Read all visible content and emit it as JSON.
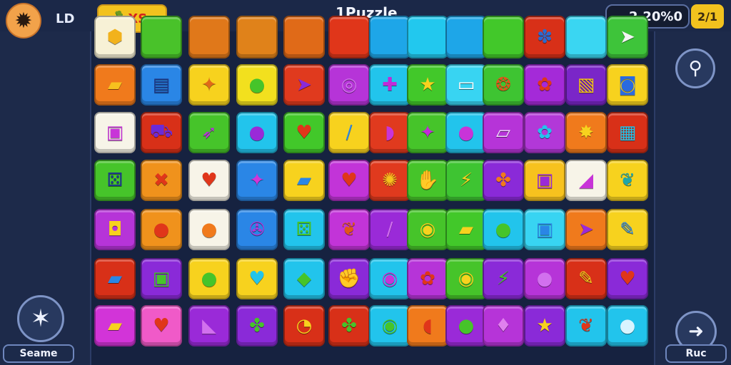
{
  "header": {
    "level_label": "LD",
    "badge_text": "XS",
    "title": "1Puzzle",
    "score": "2.20%0",
    "moves": "2/1"
  },
  "icons": {
    "gear": "gear-icon",
    "badge": "carrot-bag-icon",
    "search": "search-icon",
    "star": "star-icon",
    "arrow": "arrow-icon"
  },
  "buttons": {
    "left_label": "Seame",
    "right_label": "Ruc"
  },
  "colors": {
    "background": "#1d2a4a",
    "accent": "#f2c21e"
  },
  "grid": {
    "rows": [
      [
        {
          "name": "half-tile",
          "bg": "#f7f1d6",
          "glyph": "⬢",
          "fg": "#f2b21c"
        },
        {
          "name": "green-tile",
          "bg": "#49c22a",
          "glyph": "",
          "fg": "#fff"
        },
        {
          "name": "orange-tile",
          "bg": "#e0781a",
          "glyph": "",
          "fg": "#fff"
        },
        {
          "name": "orange-tile",
          "bg": "#e0821a",
          "glyph": "",
          "fg": "#fff"
        },
        {
          "name": "orange-tile",
          "bg": "#e06a18",
          "glyph": "",
          "fg": "#fff"
        },
        {
          "name": "red-tile",
          "bg": "#e0361a",
          "glyph": "",
          "fg": "#fff"
        },
        {
          "name": "blue-tile",
          "bg": "#1ea6e8",
          "glyph": "",
          "fg": "#fff"
        },
        {
          "name": "cyan-tile",
          "bg": "#22c8ee",
          "glyph": "",
          "fg": "#fff"
        },
        {
          "name": "blue-tile",
          "bg": "#1ea6e8",
          "glyph": "",
          "fg": "#fff"
        },
        {
          "name": "green-tile",
          "bg": "#42c82a",
          "glyph": "",
          "fg": "#fff"
        },
        {
          "name": "red-tile",
          "bg": "#d83018",
          "glyph": "✽",
          "fg": "#2a6ad0"
        },
        {
          "name": "cyan-tile",
          "bg": "#3ad6f2",
          "glyph": "",
          "fg": "#fff"
        },
        {
          "name": "green-tile",
          "bg": "#3ec43a",
          "glyph": "➤",
          "fg": "#f4f4f4"
        }
      ],
      [
        {
          "name": "orange-tile",
          "bg": "#f07a1c",
          "glyph": "▰",
          "fg": "#f7c21e"
        },
        {
          "name": "blue-tile",
          "bg": "#2a86e6",
          "glyph": "▤",
          "fg": "#1e3a8a"
        },
        {
          "name": "yellow-tile",
          "bg": "#f7d21e",
          "glyph": "✦",
          "fg": "#e06a18"
        },
        {
          "name": "yellow-tile",
          "bg": "#f2e01e",
          "glyph": "●",
          "fg": "#46c42a"
        },
        {
          "name": "red-tile",
          "bg": "#e03a1e",
          "glyph": "➤",
          "fg": "#8a2ad8"
        },
        {
          "name": "purple-tile",
          "bg": "#b634d8",
          "glyph": "◎",
          "fg": "#d270ee"
        },
        {
          "name": "cyan-tile",
          "bg": "#22c4ec",
          "glyph": "✚",
          "fg": "#c22ad8"
        },
        {
          "name": "green-tile",
          "bg": "#42c82a",
          "glyph": "★",
          "fg": "#f7d21e"
        },
        {
          "name": "cyan-tile",
          "bg": "#38d4f2",
          "glyph": "▭",
          "fg": "#ffffff"
        },
        {
          "name": "green-tile",
          "bg": "#3ec432",
          "glyph": "❂",
          "fg": "#e0561a"
        },
        {
          "name": "purple-tile",
          "bg": "#a42ad8",
          "glyph": "✿",
          "fg": "#e0361a"
        },
        {
          "name": "purple-tile",
          "bg": "#7a26c8",
          "glyph": "▧",
          "fg": "#f2c21e"
        },
        {
          "name": "yellow-tile",
          "bg": "#f7d21e",
          "glyph": "◙",
          "fg": "#2a6ae0"
        }
      ],
      [
        {
          "name": "white-tile",
          "bg": "#f7f4e8",
          "glyph": "▣",
          "fg": "#c834d8"
        },
        {
          "name": "red-tile",
          "bg": "#d83018",
          "glyph": "⛟",
          "fg": "#6a2ad8"
        },
        {
          "name": "green-tile",
          "bg": "#46c42a",
          "glyph": "➶",
          "fg": "#b634d8"
        },
        {
          "name": "cyan-tile",
          "bg": "#22c4ec",
          "glyph": "●",
          "fg": "#9a2ad8"
        },
        {
          "name": "green-tile",
          "bg": "#42c82a",
          "glyph": "♥",
          "fg": "#e0361a"
        },
        {
          "name": "yellow-tile",
          "bg": "#f7d21e",
          "glyph": "/",
          "fg": "#2a86e6"
        },
        {
          "name": "red-tile",
          "bg": "#e03a1e",
          "glyph": "◗",
          "fg": "#c834d8"
        },
        {
          "name": "green-tile",
          "bg": "#46c42a",
          "glyph": "✦",
          "fg": "#c22ad8"
        },
        {
          "name": "cyan-tile",
          "bg": "#22c4ec",
          "glyph": "●",
          "fg": "#c834d8"
        },
        {
          "name": "purple-tile",
          "bg": "#b634d8",
          "glyph": "▱",
          "fg": "#f4e0ff"
        },
        {
          "name": "purple-tile",
          "bg": "#b238d8",
          "glyph": "✿",
          "fg": "#22c4ec"
        },
        {
          "name": "orange-tile",
          "bg": "#f07a1c",
          "glyph": "✸",
          "fg": "#f7d21e"
        },
        {
          "name": "red-tile",
          "bg": "#d83018",
          "glyph": "▦",
          "fg": "#22c4ec"
        }
      ],
      [
        {
          "name": "green-tile",
          "bg": "#46c42a",
          "glyph": "⚄",
          "fg": "#1e3a8a"
        },
        {
          "name": "orange-tile",
          "bg": "#f0921c",
          "glyph": "✖",
          "fg": "#e0361a"
        },
        {
          "name": "white-tile",
          "bg": "#f7f4e8",
          "glyph": "♥",
          "fg": "#e0361a"
        },
        {
          "name": "blue-tile",
          "bg": "#2a86e6",
          "glyph": "✦",
          "fg": "#d234d8"
        },
        {
          "name": "yellow-tile",
          "bg": "#f7d21e",
          "glyph": "▰",
          "fg": "#2a86e6"
        },
        {
          "name": "purple-tile",
          "bg": "#c234d8",
          "glyph": "♥",
          "fg": "#e0361a"
        },
        {
          "name": "red-tile",
          "bg": "#e03a1e",
          "glyph": "✺",
          "fg": "#f7c21e"
        },
        {
          "name": "green-tile",
          "bg": "#46c42a",
          "glyph": "✋",
          "fg": "#1e7ad8"
        },
        {
          "name": "green-tile",
          "bg": "#3ec432",
          "glyph": "⚡",
          "fg": "#f7d21e"
        },
        {
          "name": "purple-tile",
          "bg": "#8a2ad8",
          "glyph": "✤",
          "fg": "#f07a1c"
        },
        {
          "name": "yellow-tile",
          "bg": "#f7c21e",
          "glyph": "▣",
          "fg": "#9a2ad8"
        },
        {
          "name": "white-tile",
          "bg": "#f7f4e8",
          "glyph": "◢",
          "fg": "#c834d8"
        },
        {
          "name": "yellow-tile",
          "bg": "#f7d21e",
          "glyph": "❦",
          "fg": "#1ea6a8"
        }
      ],
      [
        {
          "name": "purple-tile",
          "bg": "#b634d8",
          "glyph": "◘",
          "fg": "#f7d21e"
        },
        {
          "name": "orange-tile",
          "bg": "#f0921c",
          "glyph": "●",
          "fg": "#e0361a"
        },
        {
          "name": "white-tile",
          "bg": "#f7f4e8",
          "glyph": "●",
          "fg": "#f07a1c"
        },
        {
          "name": "blue-tile",
          "bg": "#2a86e6",
          "glyph": "✇",
          "fg": "#b634d8"
        },
        {
          "name": "cyan-tile",
          "bg": "#22c4ec",
          "glyph": "⚄",
          "fg": "#46c42a"
        },
        {
          "name": "purple-tile",
          "bg": "#c234d8",
          "glyph": "❦",
          "fg": "#e0561a"
        },
        {
          "name": "purple-tile",
          "bg": "#9a2ad8",
          "glyph": "/",
          "fg": "#d270ee"
        },
        {
          "name": "green-tile",
          "bg": "#46c42a",
          "glyph": "◉",
          "fg": "#f7d21e"
        },
        {
          "name": "green-tile",
          "bg": "#42c82a",
          "glyph": "▰",
          "fg": "#f7d21e"
        },
        {
          "name": "cyan-tile",
          "bg": "#22c4ec",
          "glyph": "●",
          "fg": "#46c42a"
        },
        {
          "name": "cyan-tile",
          "bg": "#38d4f2",
          "glyph": "▣",
          "fg": "#2a86e6"
        },
        {
          "name": "orange-tile",
          "bg": "#f07a1c",
          "glyph": "➤",
          "fg": "#9a2ad8"
        },
        {
          "name": "yellow-tile",
          "bg": "#f7d21e",
          "glyph": "✎",
          "fg": "#2a86e6"
        }
      ],
      [
        {
          "name": "red-tile",
          "bg": "#d83018",
          "glyph": "▰",
          "fg": "#2a86e6"
        },
        {
          "name": "purple-tile",
          "bg": "#8a2ad8",
          "glyph": "▣",
          "fg": "#46c42a"
        },
        {
          "name": "yellow-tile",
          "bg": "#f7d21e",
          "glyph": "●",
          "fg": "#46c42a"
        },
        {
          "name": "yellow-tile",
          "bg": "#f7d21e",
          "glyph": "♥",
          "fg": "#22c4ec"
        },
        {
          "name": "cyan-tile",
          "bg": "#22c4ec",
          "glyph": "◆",
          "fg": "#46c42a"
        },
        {
          "name": "purple-tile",
          "bg": "#8a2ad8",
          "glyph": "✊",
          "fg": "#46c42a"
        },
        {
          "name": "cyan-tile",
          "bg": "#22c4ec",
          "glyph": "◉",
          "fg": "#c834d8"
        },
        {
          "name": "purple-tile",
          "bg": "#b634d8",
          "glyph": "✿",
          "fg": "#e0361a"
        },
        {
          "name": "green-tile",
          "bg": "#46c42a",
          "glyph": "◉",
          "fg": "#f7d21e"
        },
        {
          "name": "purple-tile",
          "bg": "#8a2ad8",
          "glyph": "⚡",
          "fg": "#46c42a"
        },
        {
          "name": "purple-tile",
          "bg": "#b634d8",
          "glyph": "●",
          "fg": "#d270ee"
        },
        {
          "name": "red-tile",
          "bg": "#d83018",
          "glyph": "✎",
          "fg": "#f7d21e"
        },
        {
          "name": "purple-tile",
          "bg": "#8a2ad8",
          "glyph": "♥",
          "fg": "#e0361a"
        }
      ],
      [
        {
          "name": "purple-tile",
          "bg": "#d234d8",
          "glyph": "▰",
          "fg": "#f7d21e"
        },
        {
          "name": "pink-tile",
          "bg": "#f05ac8",
          "glyph": "♥",
          "fg": "#e0361a"
        },
        {
          "name": "purple-tile",
          "bg": "#9a2ad8",
          "glyph": "◣",
          "fg": "#d270ee"
        },
        {
          "name": "purple-tile",
          "bg": "#8a2ad8",
          "glyph": "✤",
          "fg": "#46c42a"
        },
        {
          "name": "red-tile",
          "bg": "#d83018",
          "glyph": "◔",
          "fg": "#f7d21e"
        },
        {
          "name": "red-tile",
          "bg": "#d83018",
          "glyph": "✤",
          "fg": "#46c42a"
        },
        {
          "name": "cyan-tile",
          "bg": "#22c4ec",
          "glyph": "◉",
          "fg": "#46c42a"
        },
        {
          "name": "orange-tile",
          "bg": "#f07a1c",
          "glyph": "◖",
          "fg": "#e0361a"
        },
        {
          "name": "purple-tile",
          "bg": "#9a2ad8",
          "glyph": "●",
          "fg": "#46c42a"
        },
        {
          "name": "purple-tile",
          "bg": "#b634d8",
          "glyph": "♦",
          "fg": "#e080ee"
        },
        {
          "name": "purple-tile",
          "bg": "#8a2ad8",
          "glyph": "★",
          "fg": "#f7d21e"
        },
        {
          "name": "cyan-tile",
          "bg": "#22c4ec",
          "glyph": "❦",
          "fg": "#e0361a"
        },
        {
          "name": "cyan-tile",
          "bg": "#22c4ec",
          "glyph": "●",
          "fg": "#d8f4ff"
        }
      ]
    ]
  }
}
